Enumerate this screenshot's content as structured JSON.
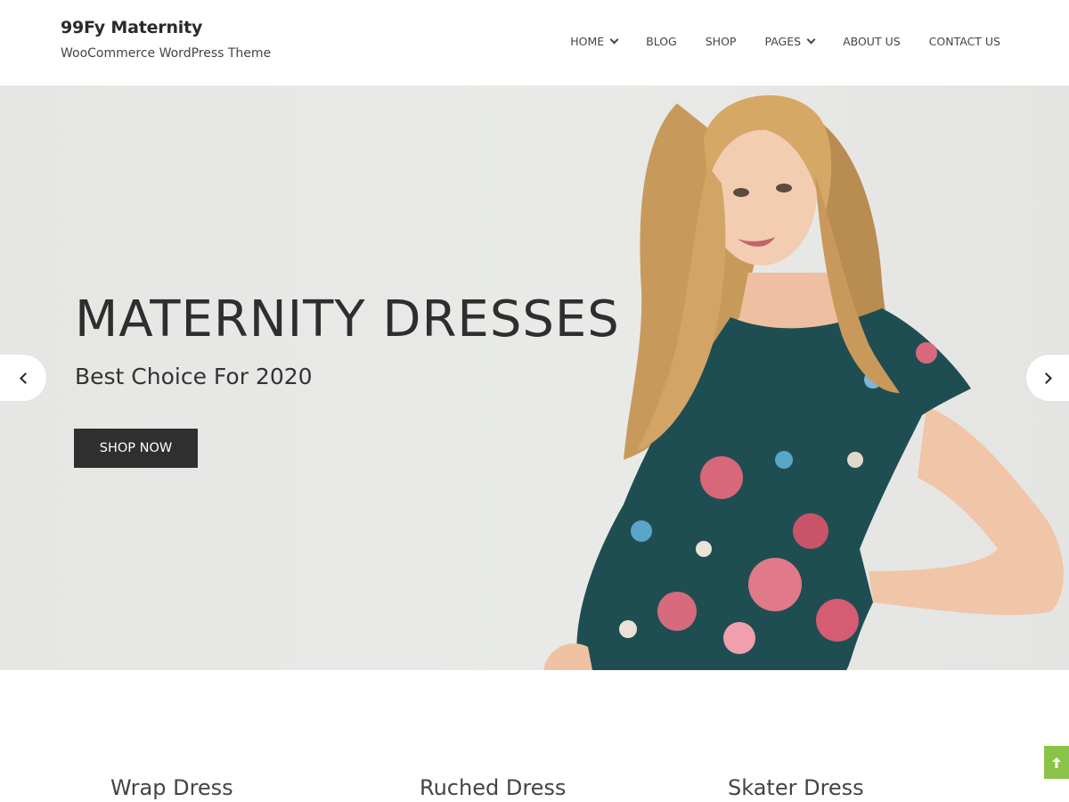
{
  "header": {
    "site_title": "99Fy Maternity",
    "tagline": "WooCommerce WordPress Theme",
    "nav": [
      {
        "label": "HOME",
        "has_dropdown": true
      },
      {
        "label": "BLOG",
        "has_dropdown": false
      },
      {
        "label": "SHOP",
        "has_dropdown": false
      },
      {
        "label": "PAGES",
        "has_dropdown": true
      },
      {
        "label": "ABOUT US",
        "has_dropdown": false
      },
      {
        "label": "CONTACT US",
        "has_dropdown": false
      }
    ]
  },
  "hero": {
    "title": "MATERNITY DRESSES",
    "subtitle": "Best Choice For 2020",
    "button_label": "SHOP NOW",
    "prev_icon": "chevron-left-icon",
    "next_icon": "chevron-right-icon",
    "colors": {
      "background": "#e8e9e6",
      "button": "#2f2f2f",
      "dress": "#1f4e52"
    }
  },
  "categories": [
    {
      "label": "Wrap Dress"
    },
    {
      "label": "Ruched Dress"
    },
    {
      "label": "Skater Dress"
    }
  ],
  "scroll_top": {
    "icon": "arrow-up-icon",
    "color": "#8bc34a"
  }
}
